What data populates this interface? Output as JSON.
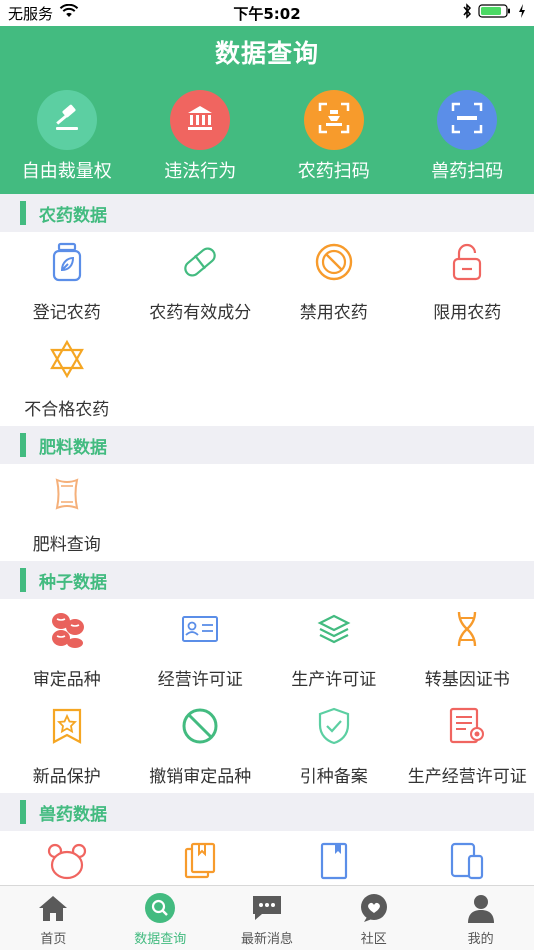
{
  "status_bar": {
    "carrier": "无服务",
    "time": "下午5:02"
  },
  "header": {
    "title": "数据查询",
    "quick_actions": [
      {
        "label": "自由裁量权",
        "icon": "gavel-icon",
        "color": "#5ccfa2"
      },
      {
        "label": "违法行为",
        "icon": "courthouse-icon",
        "color": "#f06560"
      },
      {
        "label": "农药扫码",
        "icon": "scan-code-icon",
        "color": "#f79b2c"
      },
      {
        "label": "兽药扫码",
        "icon": "scan-barcode-icon",
        "color": "#5b8ee8"
      }
    ]
  },
  "sections": [
    {
      "title": "农药数据",
      "items": [
        {
          "label": "登记农药",
          "icon": "pesticide-bottle-icon"
        },
        {
          "label": "农药有效成分",
          "icon": "capsule-icon"
        },
        {
          "label": "禁用农药",
          "icon": "forbidden-icon"
        },
        {
          "label": "限用农药",
          "icon": "lock-icon"
        },
        {
          "label": "不合格农药",
          "icon": "star-of-david-icon"
        }
      ]
    },
    {
      "title": "肥料数据",
      "items": [
        {
          "label": "肥料查询",
          "icon": "fertilizer-bag-icon"
        }
      ]
    },
    {
      "title": "种子数据",
      "items": [
        {
          "label": "审定品种",
          "icon": "seeds-icon"
        },
        {
          "label": "经营许可证",
          "icon": "id-card-icon"
        },
        {
          "label": "生产许可证",
          "icon": "layers-icon"
        },
        {
          "label": "转基因证书",
          "icon": "dna-icon"
        },
        {
          "label": "新品保护",
          "icon": "star-badge-icon"
        },
        {
          "label": "撤销审定品种",
          "icon": "cancel-icon"
        },
        {
          "label": "引种备案",
          "icon": "shield-check-icon"
        },
        {
          "label": "生产经营许可证",
          "icon": "certificate-icon"
        }
      ]
    },
    {
      "title": "兽药数据",
      "items": [
        {
          "label": "",
          "icon": "bear-icon"
        },
        {
          "label": "",
          "icon": "books-icon"
        },
        {
          "label": "",
          "icon": "bookmark-book-icon"
        },
        {
          "label": "",
          "icon": "devices-icon"
        }
      ]
    }
  ],
  "tab_bar": {
    "active": 1,
    "tabs": [
      {
        "label": "首页",
        "icon": "home-icon"
      },
      {
        "label": "数据查询",
        "icon": "search-icon"
      },
      {
        "label": "最新消息",
        "icon": "message-icon"
      },
      {
        "label": "社区",
        "icon": "community-icon"
      },
      {
        "label": "我的",
        "icon": "profile-icon"
      }
    ]
  }
}
